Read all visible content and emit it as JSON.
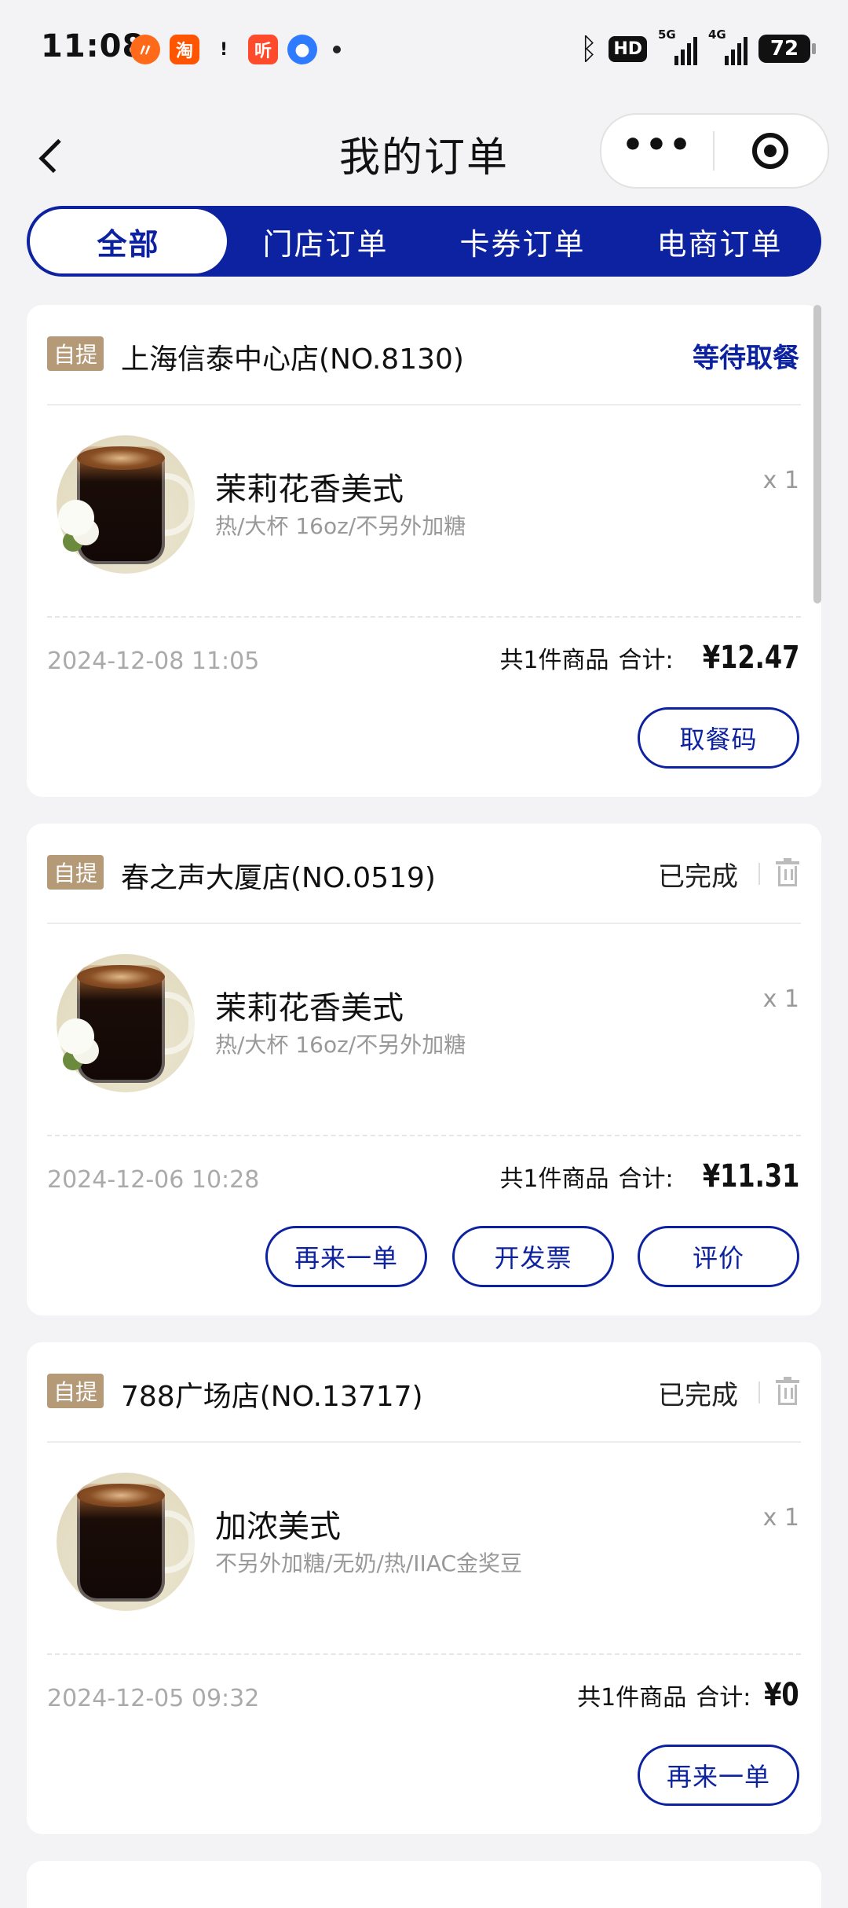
{
  "status_bar": {
    "time": "11:08",
    "notifications": [
      "app-orange-icon",
      "taobao-icon",
      "message-icon",
      "ting-icon",
      "blue-app-icon"
    ],
    "notif_labels": {
      "tao": "淘",
      "msg": "!",
      "ting": "听"
    },
    "network": {
      "hd": "HD",
      "sig1": "5G",
      "sig2": "4G"
    },
    "battery": "72"
  },
  "header": {
    "title": "我的订单",
    "more": "•••"
  },
  "tabs": [
    {
      "label": "全部",
      "active": true
    },
    {
      "label": "门店订单",
      "active": false
    },
    {
      "label": "卡券订单",
      "active": false
    },
    {
      "label": "电商订单",
      "active": false
    }
  ],
  "orders": [
    {
      "tag": "自提",
      "store": "上海信泰中心店(NO.8130)",
      "status": "等待取餐",
      "item": {
        "name": "茉莉花香美式",
        "spec": "热/大杯 16oz/不另外加糖",
        "qty": "x 1"
      },
      "time": "2024-12-08 11:05",
      "count_label": "共1件商品",
      "total_label": "合计:",
      "total": "¥12.47",
      "actions": [
        "取餐码"
      ]
    },
    {
      "tag": "自提",
      "store": "春之声大厦店(NO.0519)",
      "status": "已完成",
      "item": {
        "name": "茉莉花香美式",
        "spec": "热/大杯 16oz/不另外加糖",
        "qty": "x 1"
      },
      "time": "2024-12-06 10:28",
      "count_label": "共1件商品",
      "total_label": "合计:",
      "total": "¥11.31",
      "actions": [
        "再来一单",
        "开发票",
        "评价"
      ]
    },
    {
      "tag": "自提",
      "store": "788广场店(NO.13717)",
      "status": "已完成",
      "item": {
        "name": "加浓美式",
        "spec": "不另外加糖/无奶/热/IIAC金奖豆",
        "qty": "x 1"
      },
      "time": "2024-12-05 09:32",
      "count_label": "共1件商品",
      "total_label": "合计:",
      "total": "¥0",
      "actions": [
        "再来一单"
      ]
    }
  ],
  "colors": {
    "brand": "#0c22a0",
    "tag": "#b59a78",
    "background": "#f3f3f5"
  }
}
